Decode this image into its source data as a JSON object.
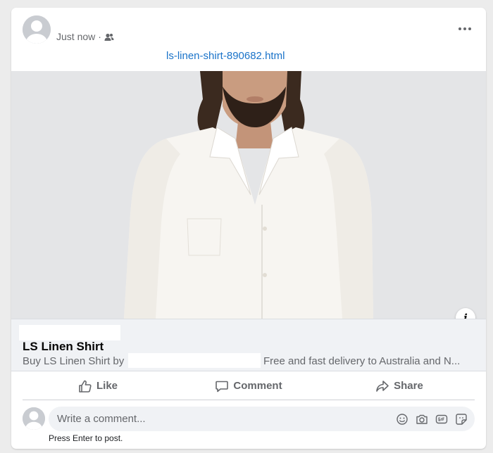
{
  "post": {
    "timestamp": "Just now",
    "separator": "·",
    "audience_icon": "friends-icon",
    "link_text": "ls-linen-shirt-890682.html"
  },
  "preview": {
    "title": "LS Linen Shirt",
    "description_prefix": "Buy LS Linen Shirt by",
    "description_suffix": "Free and fast delivery to Australia and N...",
    "info_label": "i"
  },
  "actions": {
    "like": "Like",
    "comment": "Comment",
    "share": "Share"
  },
  "comment": {
    "placeholder": "Write a comment...",
    "hint": "Press Enter to post.",
    "icons": [
      "emoji-icon",
      "camera-icon",
      "gif-icon",
      "sticker-icon"
    ]
  },
  "colors": {
    "link": "#1a73c9",
    "muted": "#65676b",
    "preview_bg": "#f0f2f5"
  }
}
